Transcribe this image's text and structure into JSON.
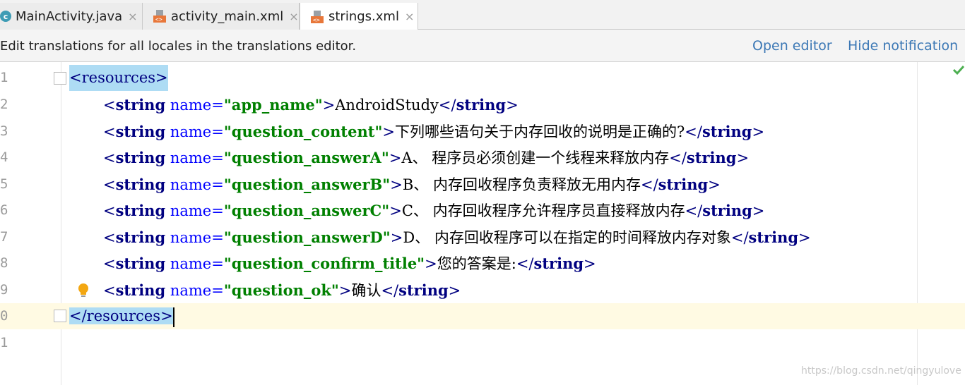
{
  "tabs": [
    {
      "label": "MainActivity.java",
      "icon": "class-c-icon",
      "active": false
    },
    {
      "label": "activity_main.xml",
      "icon": "xml-file-icon",
      "active": false
    },
    {
      "label": "strings.xml",
      "icon": "xml-file-icon",
      "active": true
    }
  ],
  "tab_close_glyph": "×",
  "notification": {
    "text": "Edit translations for all locales in the translations editor.",
    "open_editor": "Open editor",
    "hide_notification": "Hide notification"
  },
  "editor": {
    "line_numbers": [
      "1",
      "2",
      "3",
      "4",
      "5",
      "6",
      "7",
      "8",
      "9",
      "0",
      "1"
    ],
    "lines": [
      {
        "open": "<",
        "tag": "resources",
        "close": ">"
      },
      {
        "attr": "name",
        "value": "\"app_name\"",
        "text": "AndroidStudy"
      },
      {
        "attr": "name",
        "value": "\"question_content\"",
        "text": "下列哪些语句关于内存回收的说明是正确的?"
      },
      {
        "attr": "name",
        "value": "\"question_answerA\"",
        "text": "A、 程序员必须创建一个线程来释放内存"
      },
      {
        "attr": "name",
        "value": "\"question_answerB\"",
        "text": "B、 内存回收程序负责释放无用内存"
      },
      {
        "attr": "name",
        "value": "\"question_answerC\"",
        "text": "C、 内存回收程序允许程序员直接释放内存"
      },
      {
        "attr": "name",
        "value": "\"question_answerD\"",
        "text": "D、 内存回收程序可以在指定的时间释放内存对象"
      },
      {
        "attr": "name",
        "value": "\"question_confirm_title\"",
        "text": "您的答案是:"
      },
      {
        "attr": "name",
        "value": "\"question_ok\"",
        "text": "确认"
      },
      {
        "open": "</",
        "tag": "resources",
        "close": ">"
      }
    ],
    "string_tag": "string"
  },
  "watermark": "https://blog.csdn.net/qingyulove",
  "colors": {
    "tag": "#000080",
    "attr": "#0000ff",
    "value": "#008000",
    "link": "#3c78b5",
    "tag_highlight": "#aedcf4",
    "current_line": "#fffae3"
  }
}
